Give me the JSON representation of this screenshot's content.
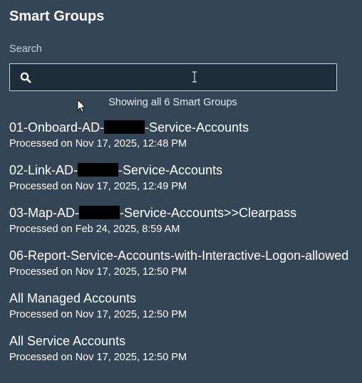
{
  "colors": {
    "background": "#344556",
    "search_background": "#1f2d3b",
    "search_border": "#c9d2da",
    "text": "#ffffff",
    "redaction": "#000000"
  },
  "panel": {
    "title": "Smart Groups",
    "search": {
      "label": "Search",
      "value": "",
      "placeholder": "",
      "icon": "search-icon"
    },
    "status_text": "Showing all 6 Smart Groups"
  },
  "groups": [
    {
      "name_parts": [
        "01-Onboard-AD-",
        "-Service-Accounts"
      ],
      "redacted": true,
      "processed": "Processed on Nov 17, 2025, 12:48 PM"
    },
    {
      "name_parts": [
        "02-Link-AD-",
        "-Service-Accounts"
      ],
      "redacted": true,
      "processed": "Processed on Nov 17, 2025, 12:49 PM"
    },
    {
      "name_parts": [
        "03-Map-AD-",
        "-Service-Accounts>>Clearpass"
      ],
      "redacted": true,
      "processed": "Processed on Feb 24, 2025, 8:59 AM"
    },
    {
      "name": "06-Report-Service-Accounts-with-Interactive-Logon-allowed",
      "processed": "Processed on Nov 17, 2025, 12:50 PM"
    },
    {
      "name": "All Managed Accounts",
      "processed": "Processed on Nov 17, 2025, 12:50 PM"
    },
    {
      "name": "All Service Accounts",
      "processed": "Processed on Nov 17, 2025, 12:50 PM"
    }
  ]
}
